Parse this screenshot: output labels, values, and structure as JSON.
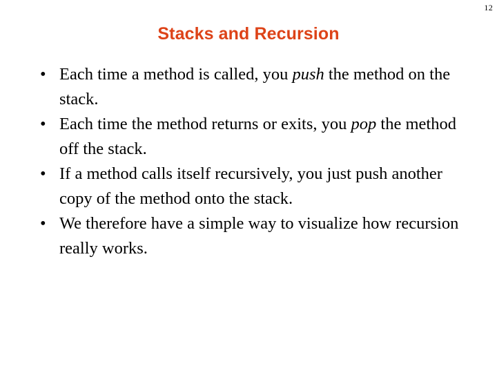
{
  "slide": {
    "page_number": "12",
    "title": "Stacks and Recursion",
    "title_color": "#DD4318",
    "background_color": "#FFFFFF",
    "text_color": "#000000",
    "bullet_marker": "•",
    "bullets": [
      {
        "marker": "•",
        "segments": [
          {
            "text": "Each time a method is called, you ",
            "style": "normal"
          },
          {
            "text": "push",
            "style": "italic"
          },
          {
            "text": " the method on the stack.",
            "style": "normal"
          }
        ],
        "plain": "Each time a method is called, you push the method on the stack."
      },
      {
        "marker": "•",
        "segments": [
          {
            "text": "Each time the method returns or exits, you ",
            "style": "normal"
          },
          {
            "text": "pop",
            "style": "italic"
          },
          {
            "text": " the method off the stack.",
            "style": "normal"
          }
        ],
        "plain": "Each time the method returns or exits, you pop the method off the stack."
      },
      {
        "marker": "•",
        "segments": [
          {
            "text": "If a method calls itself recursively, you just push another copy of the method onto the stack.",
            "style": "normal"
          }
        ],
        "plain": "If a method calls itself recursively, you just push another copy of the method onto the stack."
      },
      {
        "marker": "•",
        "segments": [
          {
            "text": "We therefore have a simple way to visualize how recursion really works.",
            "style": "normal"
          }
        ],
        "plain": "We therefore have a simple way to visualize how recursion really works."
      }
    ]
  }
}
